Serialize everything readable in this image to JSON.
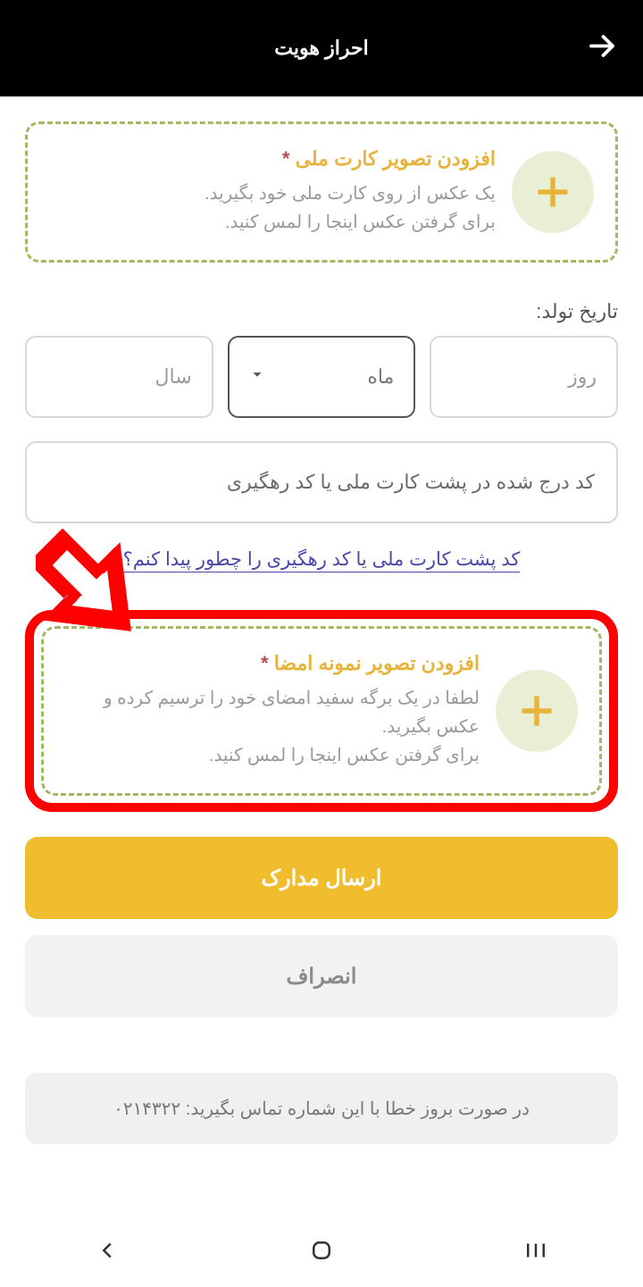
{
  "header": {
    "title": "احراز هویت"
  },
  "upload_id": {
    "title": "افزودن تصویر کارت ملی",
    "desc1": "یک عکس از روی کارت ملی خود بگیرید.",
    "desc2": "برای گرفتن عکس اینجا را لمس کنید.",
    "required": "*"
  },
  "birth": {
    "label": "تاریخ تولد:",
    "day": "روز",
    "month": "ماه",
    "year": "سال"
  },
  "code_input": {
    "placeholder": "کد درج شده در پشت کارت ملی یا کد رهگیری"
  },
  "help_link": "کد پشت کارت ملی یا کد رهگیری را چطور پیدا کنم؟",
  "upload_sig": {
    "title": "افزودن تصویر نمونه امضا",
    "desc1": "لطفا در یک برگه سفید امضای خود را ترسیم کرده و عکس بگیرید.",
    "desc2": "برای گرفتن عکس اینجا را لمس کنید.",
    "required": "*"
  },
  "buttons": {
    "submit": "ارسال مدارک",
    "cancel": "انصراف"
  },
  "error_box": "در صورت بروز خطا با این شماره تماس بگیرید: ۰۲۱۴۳۲۲"
}
